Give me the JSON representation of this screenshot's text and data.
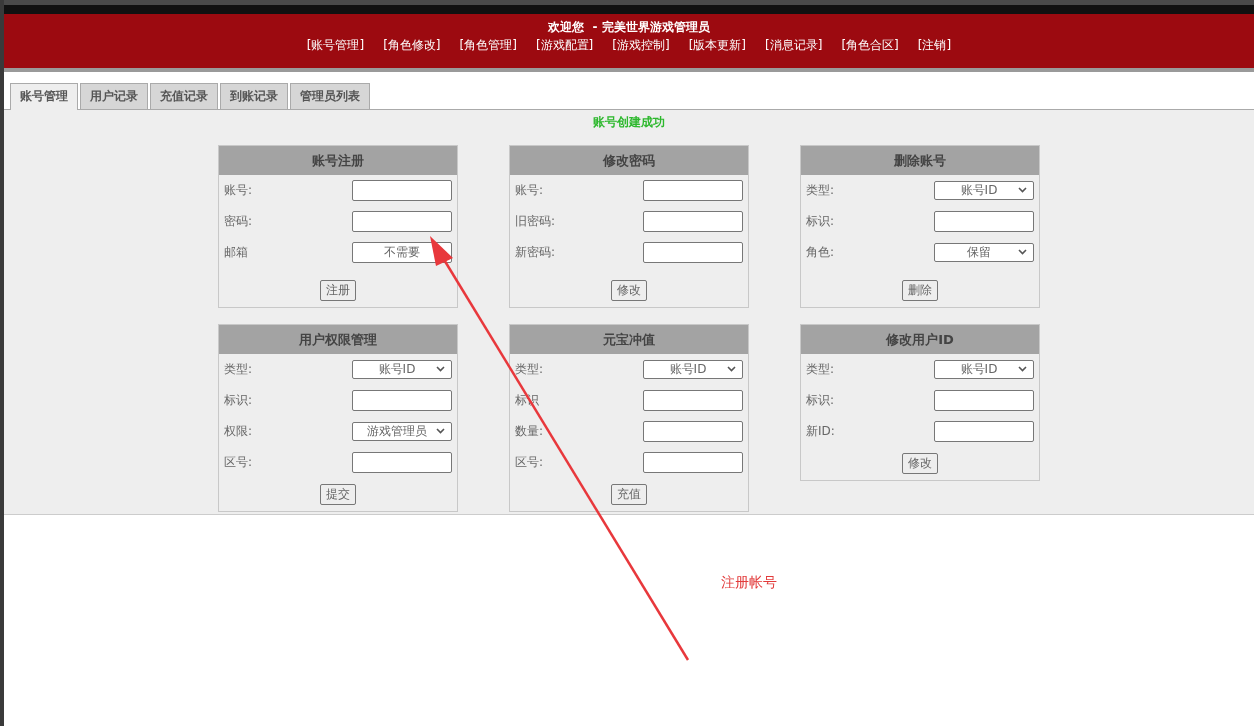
{
  "header": {
    "welcome": "欢迎您  - 完美世界游戏管理员",
    "nav": [
      "[账号管理]",
      "[角色修改]",
      "[角色管理]",
      "[游戏配置]",
      "[游戏控制]",
      "[版本更新]",
      "[消息记录]",
      "[角色合区]",
      "[注销]"
    ]
  },
  "tabs": [
    {
      "label": "账号管理",
      "selected": true
    },
    {
      "label": "用户记录",
      "selected": false
    },
    {
      "label": "充值记录",
      "selected": false
    },
    {
      "label": "到账记录",
      "selected": false
    },
    {
      "label": "管理员列表",
      "selected": false
    }
  ],
  "message": "账号创建成功",
  "panels": [
    {
      "title": "账号注册",
      "fields": [
        {
          "label": "账号:",
          "kind": "text"
        },
        {
          "label": "密码:",
          "kind": "text"
        },
        {
          "label": "邮箱",
          "kind": "text",
          "value": "不需要"
        }
      ],
      "button": "注册"
    },
    {
      "title": "修改密码",
      "fields": [
        {
          "label": "账号:",
          "kind": "text"
        },
        {
          "label": "旧密码:",
          "kind": "text"
        },
        {
          "label": "新密码:",
          "kind": "text"
        }
      ],
      "button": "修改"
    },
    {
      "title": "删除账号",
      "fields": [
        {
          "label": "类型:",
          "kind": "select",
          "value": "账号ID"
        },
        {
          "label": "标识:",
          "kind": "text"
        },
        {
          "label": "角色:",
          "kind": "select",
          "value": "保留"
        }
      ],
      "button": "删除"
    },
    {
      "title": "用户权限管理",
      "fields": [
        {
          "label": "类型:",
          "kind": "select",
          "value": "账号ID"
        },
        {
          "label": "标识:",
          "kind": "text"
        },
        {
          "label": "权限:",
          "kind": "select",
          "value": "游戏管理员"
        },
        {
          "label": "区号:",
          "kind": "text"
        }
      ],
      "button": "提交"
    },
    {
      "title": "元宝冲值",
      "fields": [
        {
          "label": "类型:",
          "kind": "select",
          "value": "账号ID"
        },
        {
          "label": "标识",
          "kind": "text"
        },
        {
          "label": "数量:",
          "kind": "text"
        },
        {
          "label": "区号:",
          "kind": "text"
        }
      ],
      "button": "充值"
    },
    {
      "title": "修改用户ID",
      "fields": [
        {
          "label": "类型:",
          "kind": "select",
          "value": "账号ID"
        },
        {
          "label": "标识:",
          "kind": "text"
        },
        {
          "label": "新ID:",
          "kind": "text"
        }
      ],
      "button": "修改"
    }
  ],
  "annotation": {
    "text": "注册帐号"
  }
}
